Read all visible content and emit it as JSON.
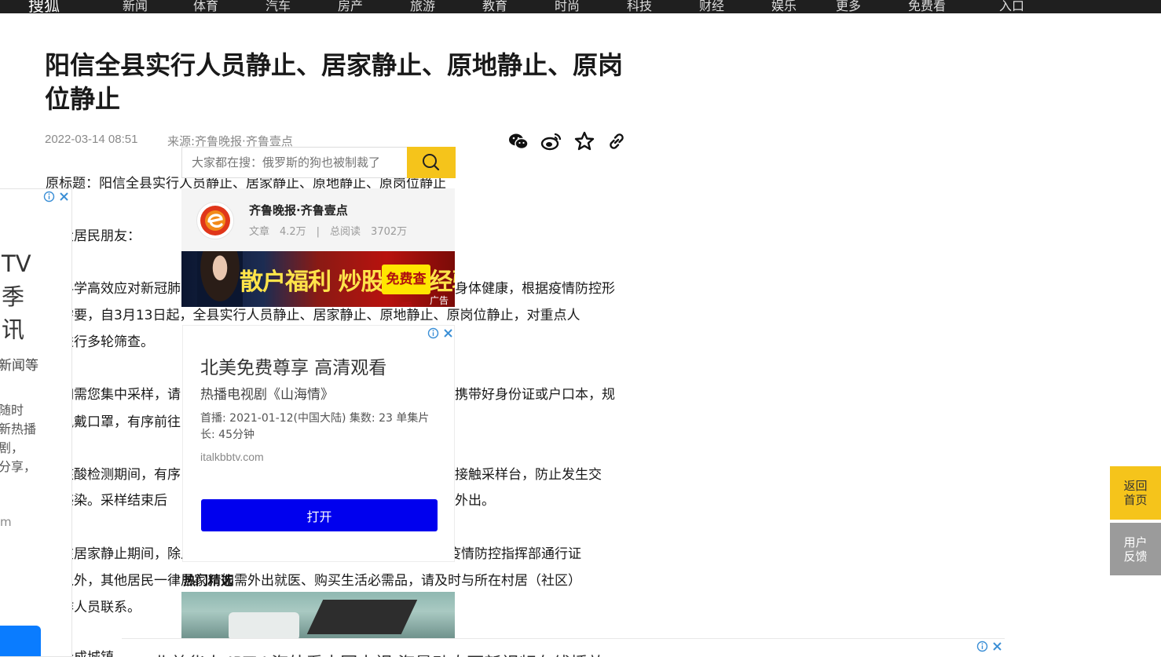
{
  "topnav": {
    "brand": "搜狐",
    "items": [
      "新闻",
      "体育",
      "汽车",
      "房产",
      "旅游",
      "教育",
      "时尚",
      "科技",
      "财经",
      "娱乐",
      "更多",
      "免费看",
      "入口"
    ]
  },
  "article": {
    "title": "阳信全县实行人员静止、居家静止、原地静止、原岗位静止",
    "date": "2022-03-14 08:51",
    "source": "来源:齐鲁晚报·齐鲁壹点",
    "lines": [
      "原标题：阳信全县实行人员静止、居家静止、原地静止、原岗位静止",
      "大居民朋友：",
      "科学高效应对新冠肺",
      "身体健康，根据疫情防控形",
      "需要，自3月13日起，全县实行人员静止、居家静止、原地静止、原岗位静止，对重点人",
      "进行多轮筛查。",
      "如需您集中采样，请",
      "携带好身份证或户口本，规",
      "佩戴口罩，有序前往",
      "核酸检测期间，有序",
      "接触采样台，防止发生交",
      "感染。采样结束后",
      "外出。",
      "在居家静止期间，除从事疫情防控相关工作及疫情保障人员可凭县疫情防控指挥部通行证",
      "入外，其他居民一律居家。如需外出就医、购买生活必需品，请及时与所在村居（社区）",
      "作人员联系。",
      "合成城镇"
    ]
  },
  "search": {
    "placeholder": "大家都在搜：俄罗斯的狗也被制裁了"
  },
  "author": {
    "name": "齐鲁晚报·齐鲁壹点",
    "stats": "文章　4.2万　|　总阅读　3702万"
  },
  "banner_ad": {
    "text": "散户福利 炒股实战经验",
    "cta": "免费查看",
    "ad_label": "广告"
  },
  "video_ad": {
    "title": "北美免费尊享 高清观看",
    "subtitle": "热播电视剧《山海情》",
    "desc": "首播: 2021-01-12(中国大陆) 集数: 23 单集片长: 45分钟",
    "domain": "italkbbtv.com",
    "open_label": "打开"
  },
  "hot_picks": {
    "title": "热门精选"
  },
  "left_ad": {
    "title": "TV\n季\n讯",
    "desc": "新闻等",
    "desc2": "随时\n新热播\n剧，\n分享，",
    "domain": "m"
  },
  "floating": {
    "back_home": "返回首页",
    "feedback": "用户反馈"
  },
  "bottom_ad": {
    "text": "北美华人 IPTV 海外看中国电视 海量动态更新视频在线播放"
  },
  "colors": {
    "accent": "#f5c41b",
    "nav_bg": "#1f1f1f",
    "ad_button": "#0000ee"
  }
}
